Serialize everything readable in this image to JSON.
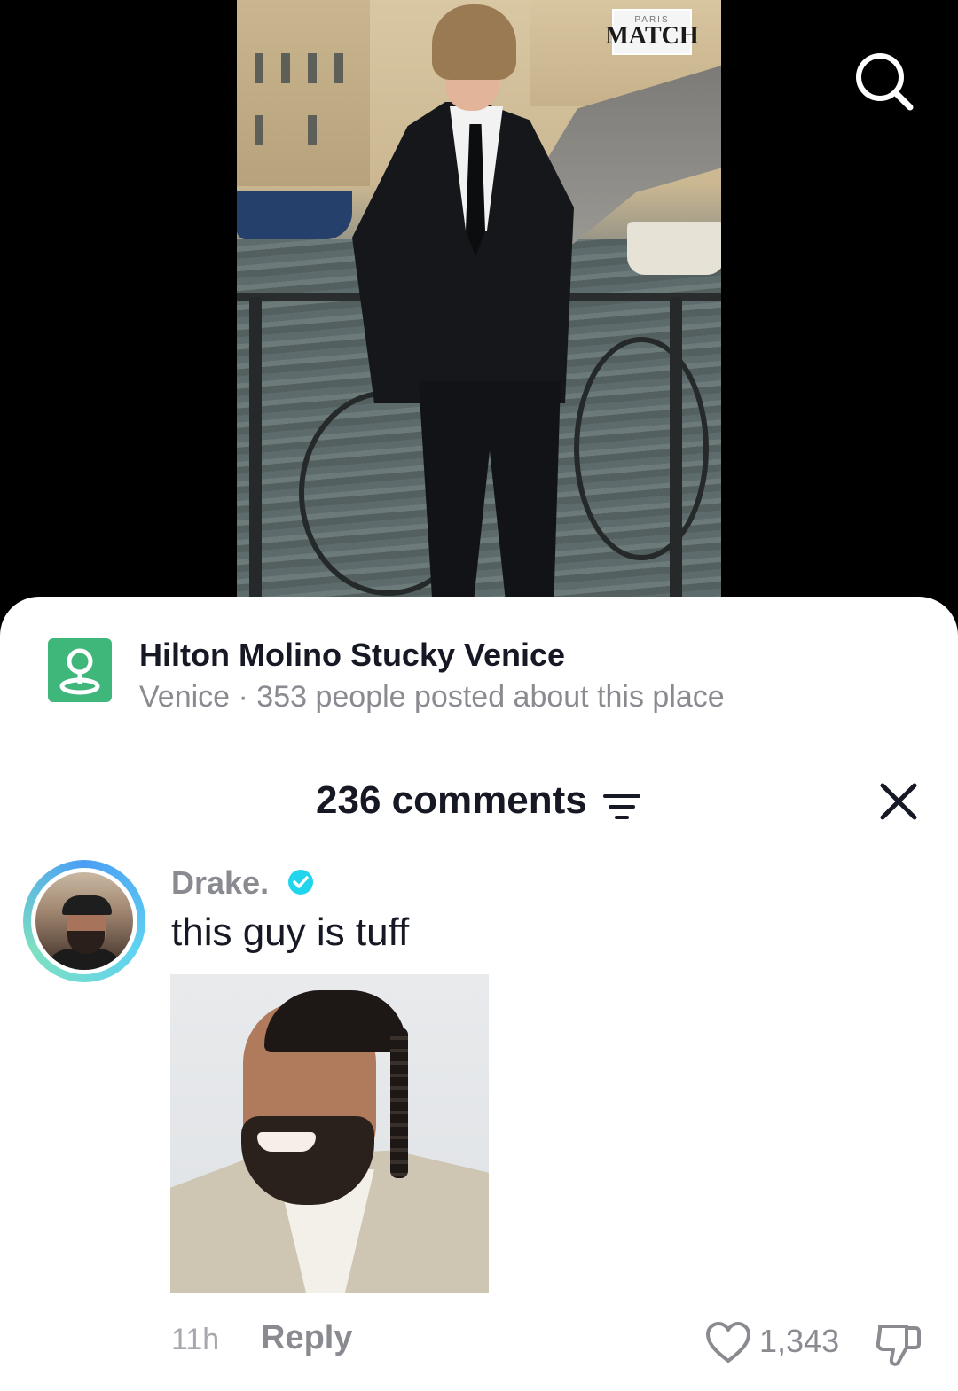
{
  "video": {
    "watermark": {
      "top": "PARIS",
      "main": "MATCH"
    }
  },
  "location": {
    "title": "Hilton Molino Stucky Venice",
    "subtitle": "Venice · 353 people posted about this place",
    "icon": "location-pin-icon",
    "accent_color": "#3fb67a"
  },
  "comments": {
    "header": "236 comments",
    "items": [
      {
        "username": "Drake.",
        "verified": true,
        "text": "this guy is tuff",
        "timestamp": "11h",
        "reply_label": "Reply",
        "likes": "1,343",
        "has_gif": true
      }
    ]
  },
  "icons": {
    "search": "search-icon",
    "filter": "sort-filter-icon",
    "close": "close-icon",
    "verified": "verified-badge-icon",
    "like": "heart-icon",
    "dislike": "thumbs-down-icon"
  },
  "colors": {
    "primary_text": "#161823",
    "secondary_text": "#8a8b91",
    "verified_blue": "#20d5ec"
  }
}
